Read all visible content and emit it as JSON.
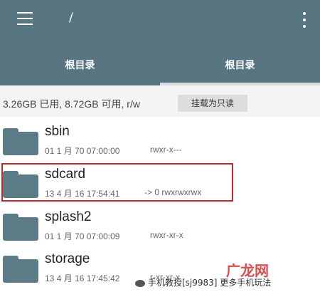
{
  "header": {
    "path": "/",
    "menu_icon": "hamburger-menu-icon",
    "more_icon": "vertical-dots-icon"
  },
  "tabs": [
    {
      "label": "根目录",
      "active": false
    },
    {
      "label": "根目录",
      "active": true
    }
  ],
  "storage": {
    "info": "3.26GB 已用, 8.72GB 可用, r/w",
    "remount_button": "挂载为只读"
  },
  "files": [
    {
      "name": "sbin",
      "date": "01 1 月 70 07:00:00",
      "perms": "rwxr-x---"
    },
    {
      "name": "sdcard",
      "date": "13 4 月 16 17:54:41",
      "perms": "-> 0  rwxrwxrwx"
    },
    {
      "name": "splash2",
      "date": "01 1 月 70 07:00:09",
      "perms": "rwxr-xr-x"
    },
    {
      "name": "storage",
      "date": "13 4 月 16 17:45:42",
      "perms": "r-xr-xr-x"
    }
  ],
  "watermark": {
    "text": "手机教授[sj9983] 更多手机玩法",
    "logo": "广龙网"
  },
  "colors": {
    "appbar": "#587582",
    "folder": "#5b7b87",
    "highlight": "#c02a2a"
  }
}
